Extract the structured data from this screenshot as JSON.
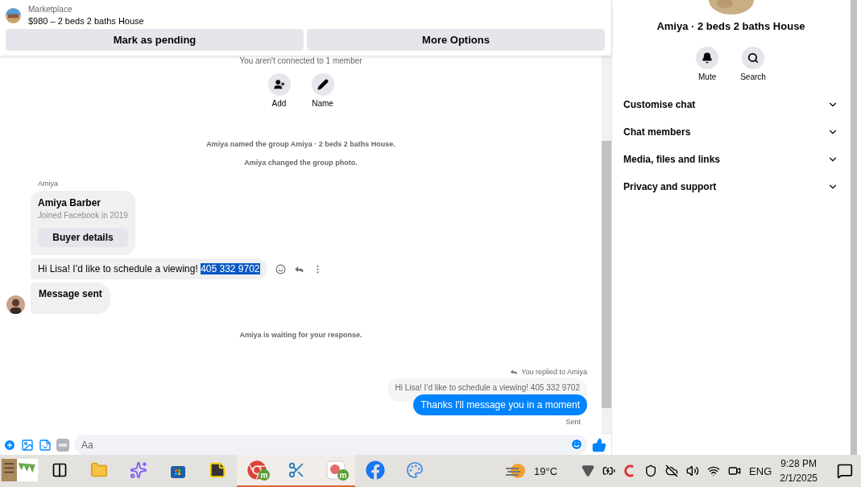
{
  "listing": {
    "category": "Marketplace",
    "title": "$980 – 2 beds 2 baths House"
  },
  "actions": [
    "Mark as pending",
    "More Options"
  ],
  "notice": "You aren't connected to 1 member",
  "quick_actions": [
    {
      "kind": "add",
      "label": "Add"
    },
    {
      "kind": "name",
      "label": "Name"
    }
  ],
  "messages": [
    {
      "kind": "event",
      "text": "Amiya named the group Amiya · 2 beds 2 baths House."
    },
    {
      "kind": "event",
      "text": "Amiya changed the group photo."
    },
    {
      "kind": "sender",
      "text": "Amiya"
    },
    {
      "kind": "card",
      "name": "Amiya Barber",
      "subtitle": "Joined Facebook in 2019",
      "button": "Buyer details"
    },
    {
      "kind": "incoming",
      "text": "Hi Lisa! I’d like to schedule a viewing!",
      "selected_text": "405 332 9702",
      "bold": false,
      "hovered": true,
      "avatar": false
    },
    {
      "kind": "incoming",
      "text": "Message sent",
      "bold": true,
      "hovered": false,
      "avatar": true
    },
    {
      "kind": "event",
      "text": "Amiya is waiting for your response."
    },
    {
      "kind": "reply_label",
      "text": "You replied to Amiya"
    },
    {
      "kind": "quote",
      "text": "Hi Lisa! I’d like to schedule a viewing! 405 332 9702"
    },
    {
      "kind": "outgoing",
      "text": "Thanks I'll message you in a moment"
    },
    {
      "kind": "status",
      "text": "Sent"
    }
  ],
  "composer": {
    "placeholder": "Aa"
  },
  "panel": {
    "title": "Amiya · 2 beds 2 baths House",
    "buttons": [
      {
        "kind": "mute",
        "label": "Mute"
      },
      {
        "kind": "search",
        "label": "Search"
      }
    ],
    "sections": [
      {
        "label": "Customise chat",
        "expanded": false
      },
      {
        "label": "Chat members",
        "expanded": false
      },
      {
        "label": "Media, files and links",
        "expanded": false
      },
      {
        "label": "Privacy and support",
        "expanded": false
      }
    ]
  },
  "taskbar": {
    "apps": [
      {
        "kind": "notes",
        "running": false
      },
      {
        "kind": "taskview",
        "running": false
      },
      {
        "kind": "explorer",
        "running": false
      },
      {
        "kind": "copilot",
        "running": false
      },
      {
        "kind": "store",
        "running": false
      },
      {
        "kind": "sticky",
        "running": false
      },
      {
        "kind": "chrome",
        "running": true,
        "badge": "m"
      },
      {
        "kind": "snip",
        "running": true
      },
      {
        "kind": "app",
        "running": true,
        "badge": "m"
      },
      {
        "kind": "facebook",
        "running": false
      },
      {
        "kind": "paint",
        "running": false
      }
    ],
    "weather": "19°C",
    "tray": [
      {
        "kind": "vpn"
      },
      {
        "kind": "battery"
      },
      {
        "kind": "cleaner"
      },
      {
        "kind": "shield"
      },
      {
        "kind": "cloud"
      },
      {
        "kind": "volume"
      },
      {
        "kind": "wifi"
      },
      {
        "kind": "camera"
      }
    ],
    "language": "ENG",
    "time": "9:28 PM",
    "date": "2/1/2025"
  }
}
